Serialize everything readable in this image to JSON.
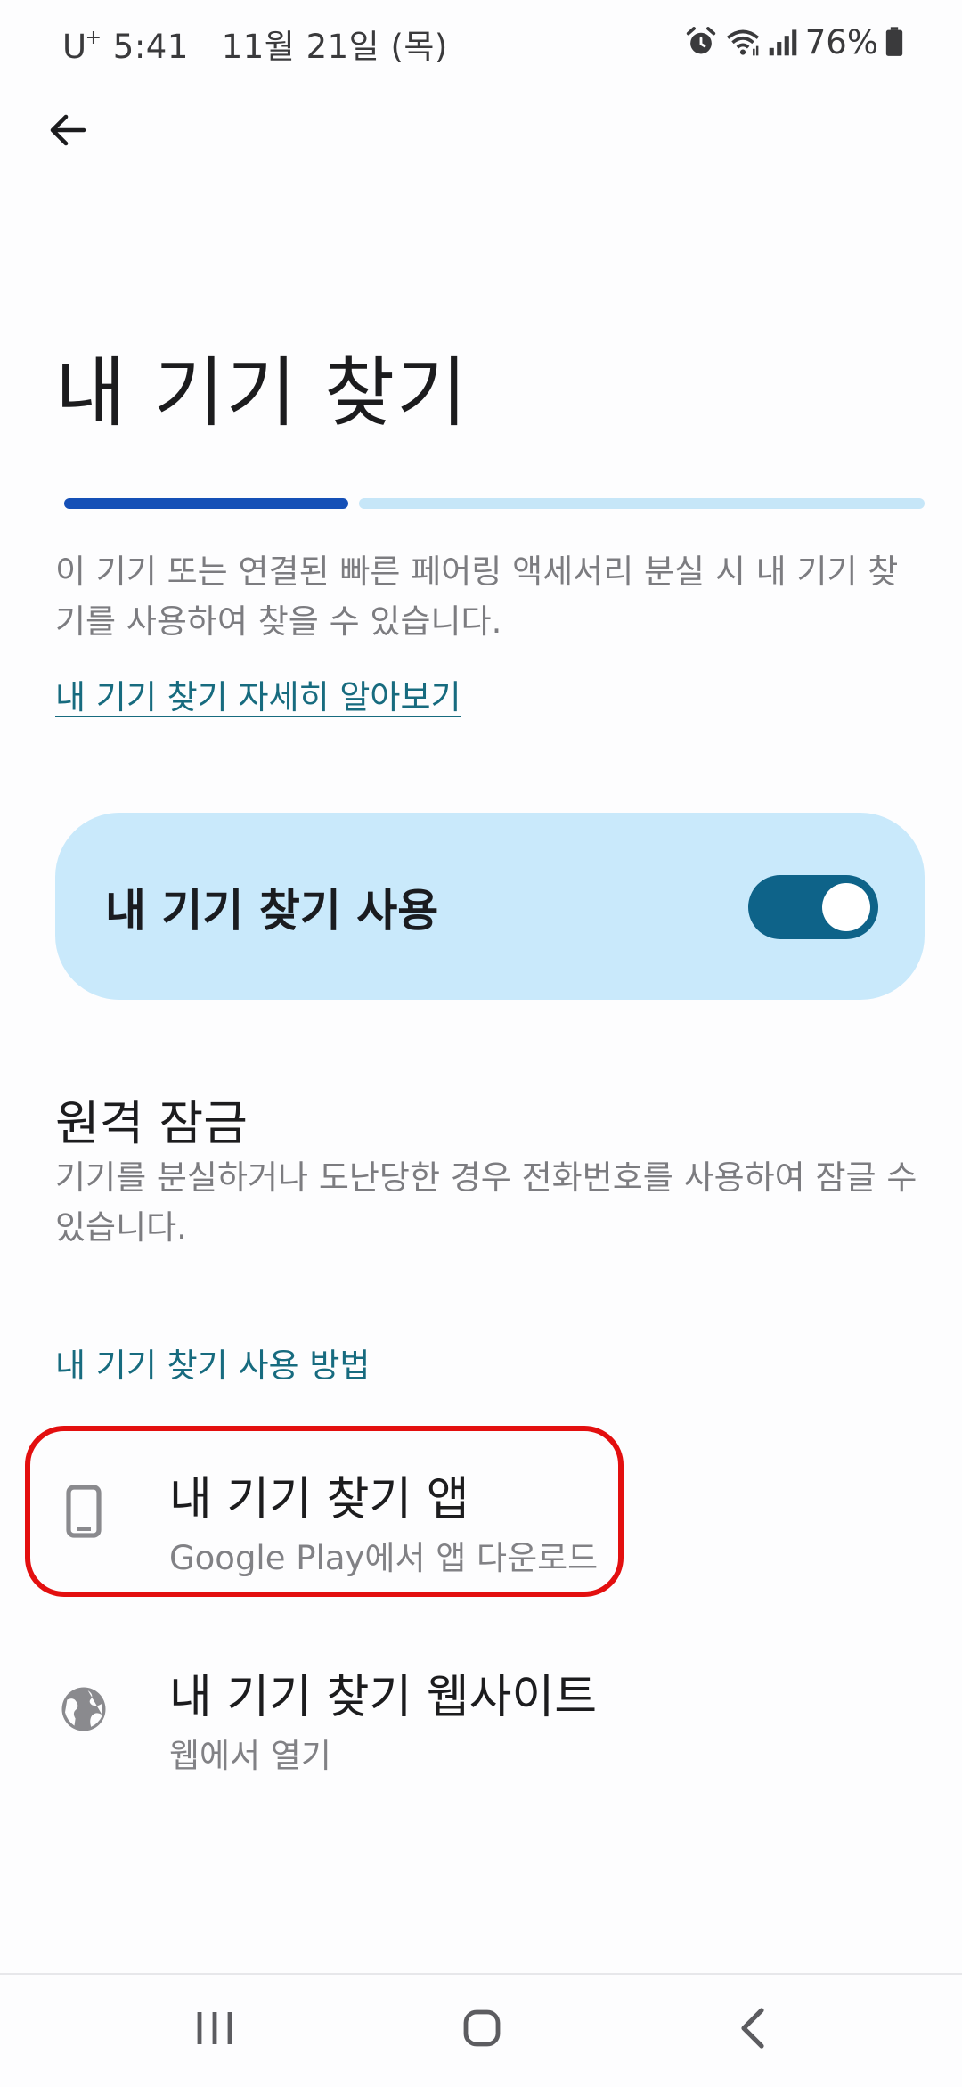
{
  "status_bar": {
    "carrier": "U",
    "carrier_sup": "+",
    "time": "5:41",
    "date": "11월 21일 (목)",
    "battery": "76%"
  },
  "page": {
    "title": "내 기기 찾기",
    "progress_fraction": 0.33,
    "description": "이 기기 또는 연결된 빠른 페어링 액세서리 분실 시 내 기기 찾기를 사용하여 찾을 수 있습니다.",
    "learn_more_link": "내 기기 찾기 자세히 알아보기"
  },
  "toggle": {
    "label": "내 기기 찾기 사용",
    "on": true,
    "colors": {
      "card": "#c9e9fb",
      "track": "#0e6389"
    }
  },
  "remote_lock": {
    "title": "원격 잠금",
    "description": "기기를 분실하거나 도난당한 경우 전화번호를 사용하여 잠글 수 있습니다."
  },
  "how_to_use": {
    "header": "내 기기 찾기 사용 방법",
    "items": [
      {
        "icon": "phone-icon",
        "title": "내 기기 찾기 앱",
        "subtitle": "Google Play에서 앱 다운로드",
        "highlighted": true
      },
      {
        "icon": "globe-icon",
        "title": "내 기기 찾기 웹사이트",
        "subtitle": "웹에서 열기",
        "highlighted": false
      }
    ]
  },
  "colors": {
    "accent_link": "#176b7f",
    "progress_done": "#1550b7",
    "progress_rest": "#c6e6f8",
    "highlight": "#e30f0f"
  },
  "nav_bar": {
    "recents": "recents-icon",
    "home": "home-icon",
    "back": "back-icon"
  }
}
